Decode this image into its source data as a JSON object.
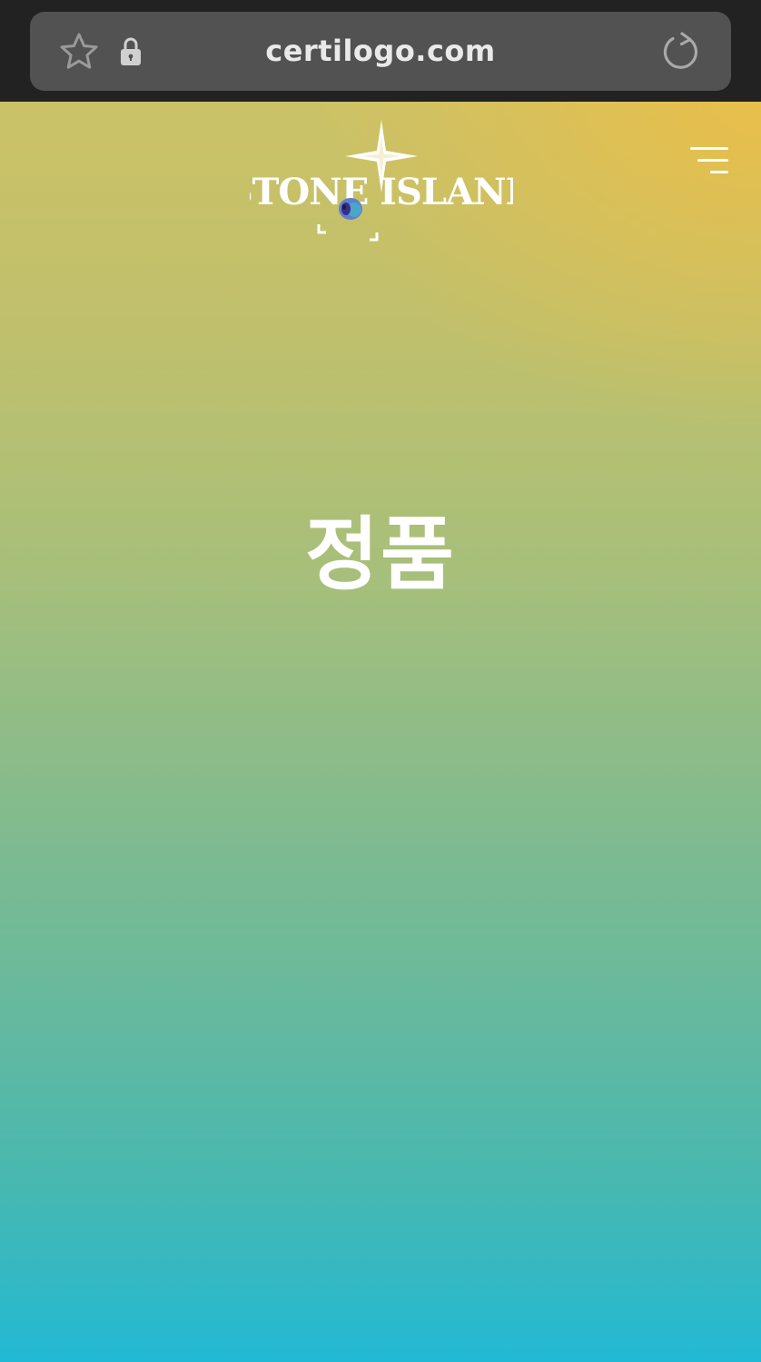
{
  "browser": {
    "url": "certilogo.com",
    "icons": {
      "bookmark": "star-icon",
      "secure": "lock-icon",
      "reload": "reload-icon"
    }
  },
  "page": {
    "logo_text": "STONE ISLAND",
    "menu_icon": "hamburger-menu-icon",
    "headline": "정품"
  },
  "colors": {
    "browser_bar": "#222222",
    "url_field": "#525252",
    "gradient_top": "#cbc267",
    "gradient_middle": "#86bb8c",
    "gradient_bottom": "#22b9d4",
    "accent_yellow": "#eebe46",
    "text": "#ffffff"
  }
}
